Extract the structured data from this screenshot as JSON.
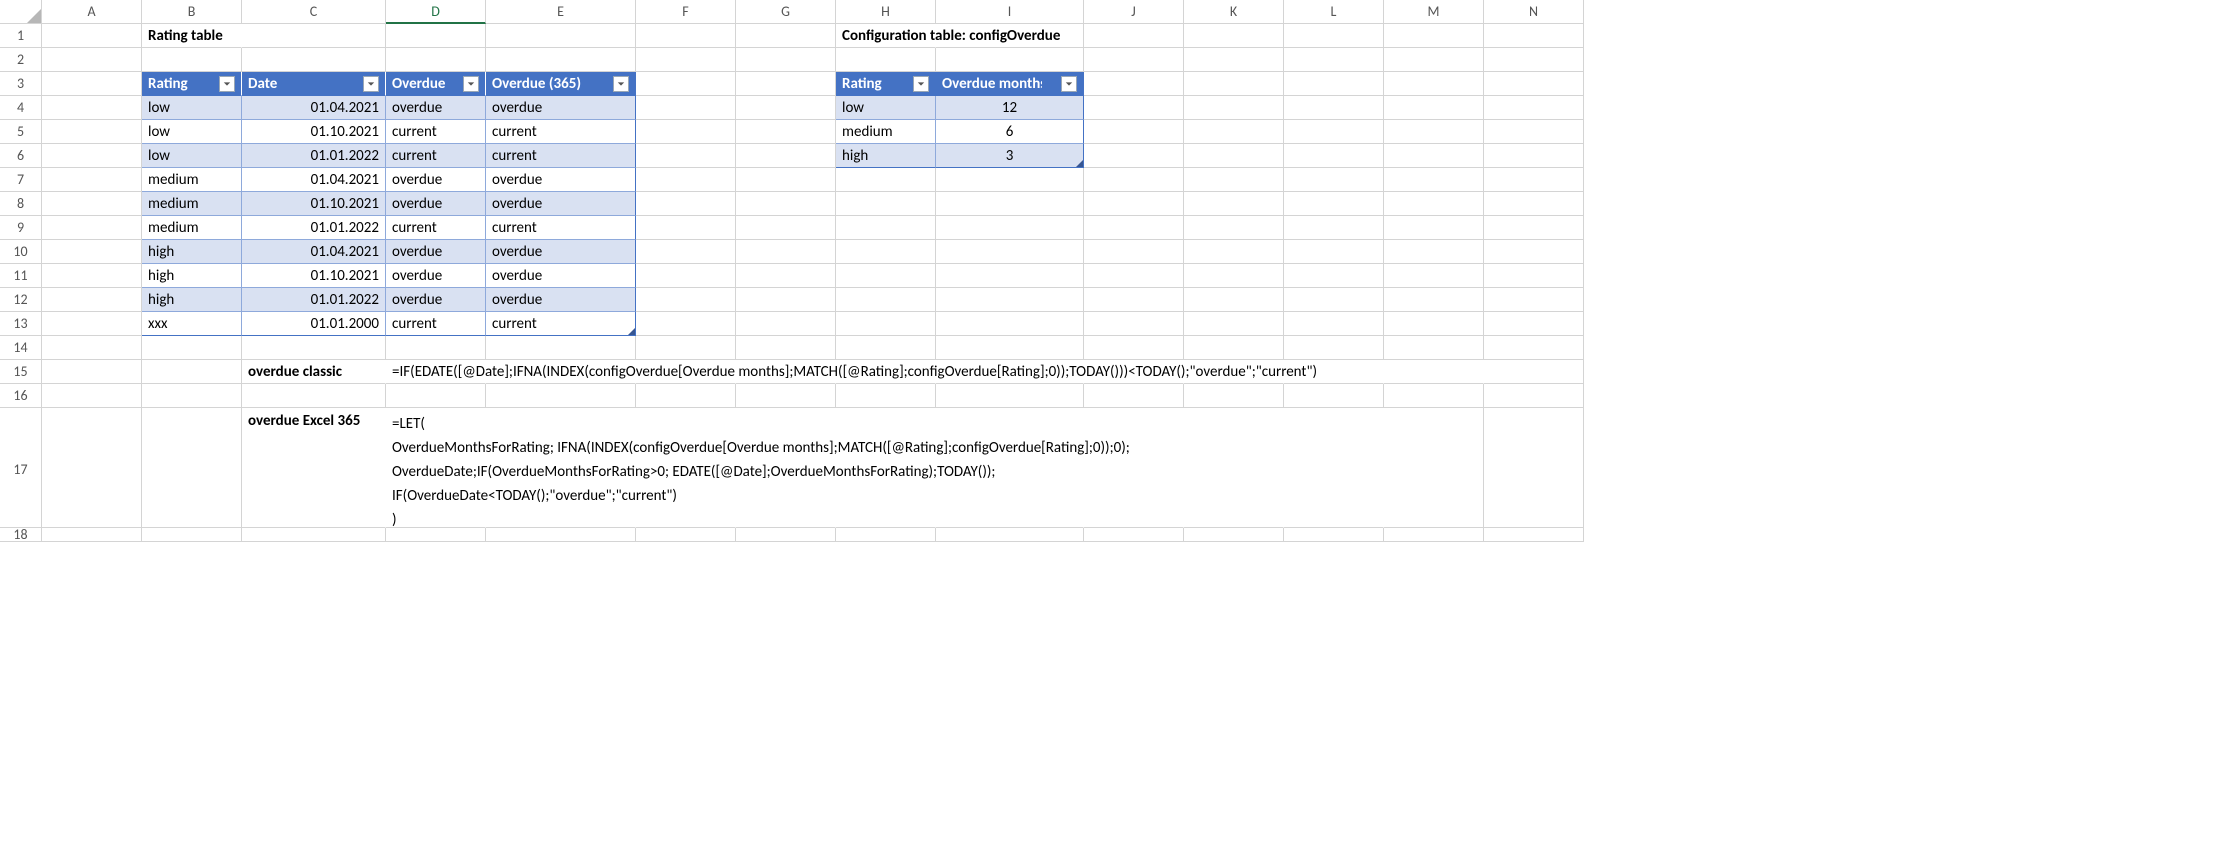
{
  "columns": [
    "A",
    "B",
    "C",
    "D",
    "E",
    "F",
    "G",
    "H",
    "I",
    "J",
    "K",
    "L",
    "M",
    "N"
  ],
  "activeColumn": "D",
  "rowCount": 18,
  "labels": {
    "ratingTableTitle": "Rating table",
    "configTableTitle": "Configuration table: configOverdue",
    "overdueClassicLabel": "overdue classic",
    "overdueExcel365Label": "overdue Excel 365"
  },
  "ratingTable": {
    "headers": [
      "Rating",
      "Date",
      "Overdue",
      "Overdue (365)"
    ],
    "rows": [
      {
        "rating": "low",
        "date": "01.04.2021",
        "overdue": "overdue",
        "overdue365": "overdue"
      },
      {
        "rating": "low",
        "date": "01.10.2021",
        "overdue": "current",
        "overdue365": "current"
      },
      {
        "rating": "low",
        "date": "01.01.2022",
        "overdue": "current",
        "overdue365": "current"
      },
      {
        "rating": "medium",
        "date": "01.04.2021",
        "overdue": "overdue",
        "overdue365": "overdue"
      },
      {
        "rating": "medium",
        "date": "01.10.2021",
        "overdue": "overdue",
        "overdue365": "overdue"
      },
      {
        "rating": "medium",
        "date": "01.01.2022",
        "overdue": "current",
        "overdue365": "current"
      },
      {
        "rating": "high",
        "date": "01.04.2021",
        "overdue": "overdue",
        "overdue365": "overdue"
      },
      {
        "rating": "high",
        "date": "01.10.2021",
        "overdue": "overdue",
        "overdue365": "overdue"
      },
      {
        "rating": "high",
        "date": "01.01.2022",
        "overdue": "overdue",
        "overdue365": "overdue"
      },
      {
        "rating": "xxx",
        "date": "01.01.2000",
        "overdue": "current",
        "overdue365": "current"
      }
    ]
  },
  "configTable": {
    "headers": [
      "Rating",
      "Overdue months"
    ],
    "rows": [
      {
        "rating": "low",
        "months": "12"
      },
      {
        "rating": "medium",
        "months": "6"
      },
      {
        "rating": "high",
        "months": "3"
      }
    ]
  },
  "formulas": {
    "classic": "=IF(EDATE([@Date];IFNA(INDEX(configOverdue[Overdue months];MATCH([@Rating];configOverdue[Rating];0));TODAY()))<TODAY();\"overdue\";\"current\")",
    "excel365": "=LET(\nOverdueMonthsForRating; IFNA(INDEX(configOverdue[Overdue months];MATCH([@Rating];configOverdue[Rating];0));0);\nOverdueDate;IF(OverdueMonthsForRating>0; EDATE([@Date];OverdueMonthsForRating);TODAY());\nIF(OverdueDate<TODAY();\"overdue\";\"current\")\n)"
  }
}
